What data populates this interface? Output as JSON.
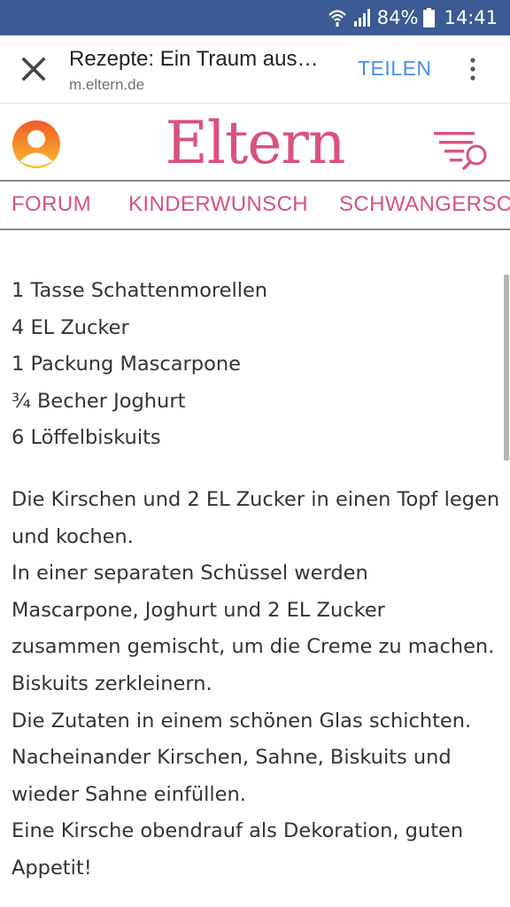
{
  "status": {
    "battery": "84%",
    "time": "14:41"
  },
  "appbar": {
    "title": "Rezepte: Ein Traum aus…",
    "url": "m.eltern.de",
    "share": "TEILEN"
  },
  "site": {
    "logo": "Eltern"
  },
  "nav": [
    "FORUM",
    "KINDERWUNSCH",
    "SCHWANGERSCHAFT"
  ],
  "ingredients": [
    "1 Tasse Schattenmorellen",
    "4 EL Zucker",
    "1 Packung Mascarpone",
    "¾ Becher Joghurt",
    "6 Löffelbiskuits"
  ],
  "steps": [
    "Die Kirschen und 2 EL Zucker in einen Topf legen",
    "und kochen.",
    "In einer separaten Schüssel werden",
    "Mascarpone, Joghurt und 2 EL Zucker",
    "zusammen gemischt, um die Creme zu machen.",
    "Biskuits zerkleinern.",
    "Die Zutaten in einem schönen Glas schichten.",
    "Nacheinander Kirschen, Sahne, Biskuits und",
    "wieder Sahne einfüllen.",
    "Eine Kirsche obendrauf als Dekoration, guten",
    "Appetit!"
  ]
}
